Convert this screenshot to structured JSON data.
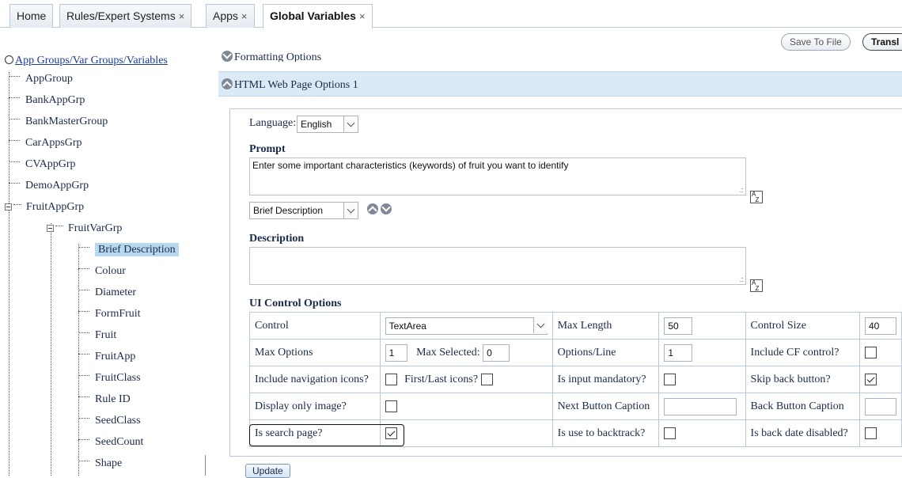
{
  "tabs": [
    {
      "label": "Home",
      "closable": false,
      "active": false
    },
    {
      "label": "Rules/Expert Systems",
      "closable": true,
      "active": false
    },
    {
      "label": "Apps",
      "closable": true,
      "active": false
    },
    {
      "label": "Global Variables",
      "closable": true,
      "active": true
    }
  ],
  "tab_close_glyph": "×",
  "toolbar": {
    "save_to_file": "Save To File",
    "translate": "Transl"
  },
  "tree": {
    "root_label": "App Groups/Var Groups/Variables",
    "groups": [
      "AppGroup",
      "BankAppGrp",
      "BankMasterGroup",
      "CarAppsGrp",
      "CVAppGrp",
      "DemoAppGrp",
      "FruitAppGrp"
    ],
    "subgroup": "FruitVarGrp",
    "variables": [
      "Brief Description",
      "Colour",
      "Diameter",
      "FormFruit",
      "Fruit",
      "FruitApp",
      "FruitClass",
      "Rule ID",
      "SeedClass",
      "SeedCount",
      "Shape"
    ],
    "selected": "Brief Description"
  },
  "sections": {
    "formatting": "Formatting Options",
    "html_web": "HTML Web Page Options 1"
  },
  "form": {
    "language_label": "Language:",
    "language_value": "English",
    "prompt_label": "Prompt",
    "prompt_text": "Enter some important characteristics (keywords) of fruit you want to identify",
    "variable_select": "Brief Description",
    "description_label": "Description",
    "description_text": "",
    "ui_control_label": "UI Control Options"
  },
  "ui_options": {
    "control_label": "Control",
    "control_value": "TextArea",
    "max_length_label": "Max Length",
    "max_length_value": "50",
    "control_size_label": "Control Size",
    "control_size_value": "40",
    "max_options_label": "Max Options",
    "max_options_value": "1",
    "max_selected_label": "Max Selected:",
    "max_selected_value": "0",
    "options_line_label": "Options/Line",
    "options_line_value": "1",
    "include_cf_label": "Include CF control?",
    "include_cf": false,
    "include_nav_label": "Include navigation icons?",
    "include_nav": false,
    "first_last_label": "First/Last icons?",
    "first_last": false,
    "input_mandatory_label": "Is input mandatory?",
    "input_mandatory": false,
    "skip_back_label": "Skip back button?",
    "skip_back": true,
    "display_image_label": "Display only image?",
    "display_image": false,
    "next_caption_label": "Next Button Caption",
    "next_caption_value": "",
    "back_caption_label": "Back Button Caption",
    "back_caption_value": "",
    "search_page_label": "Is search page?",
    "search_page": true,
    "backtrack_label": "Is use to backtrack?",
    "backtrack": false,
    "back_date_label": "Is back date disabled?",
    "back_date": false
  },
  "update_button": "Update"
}
